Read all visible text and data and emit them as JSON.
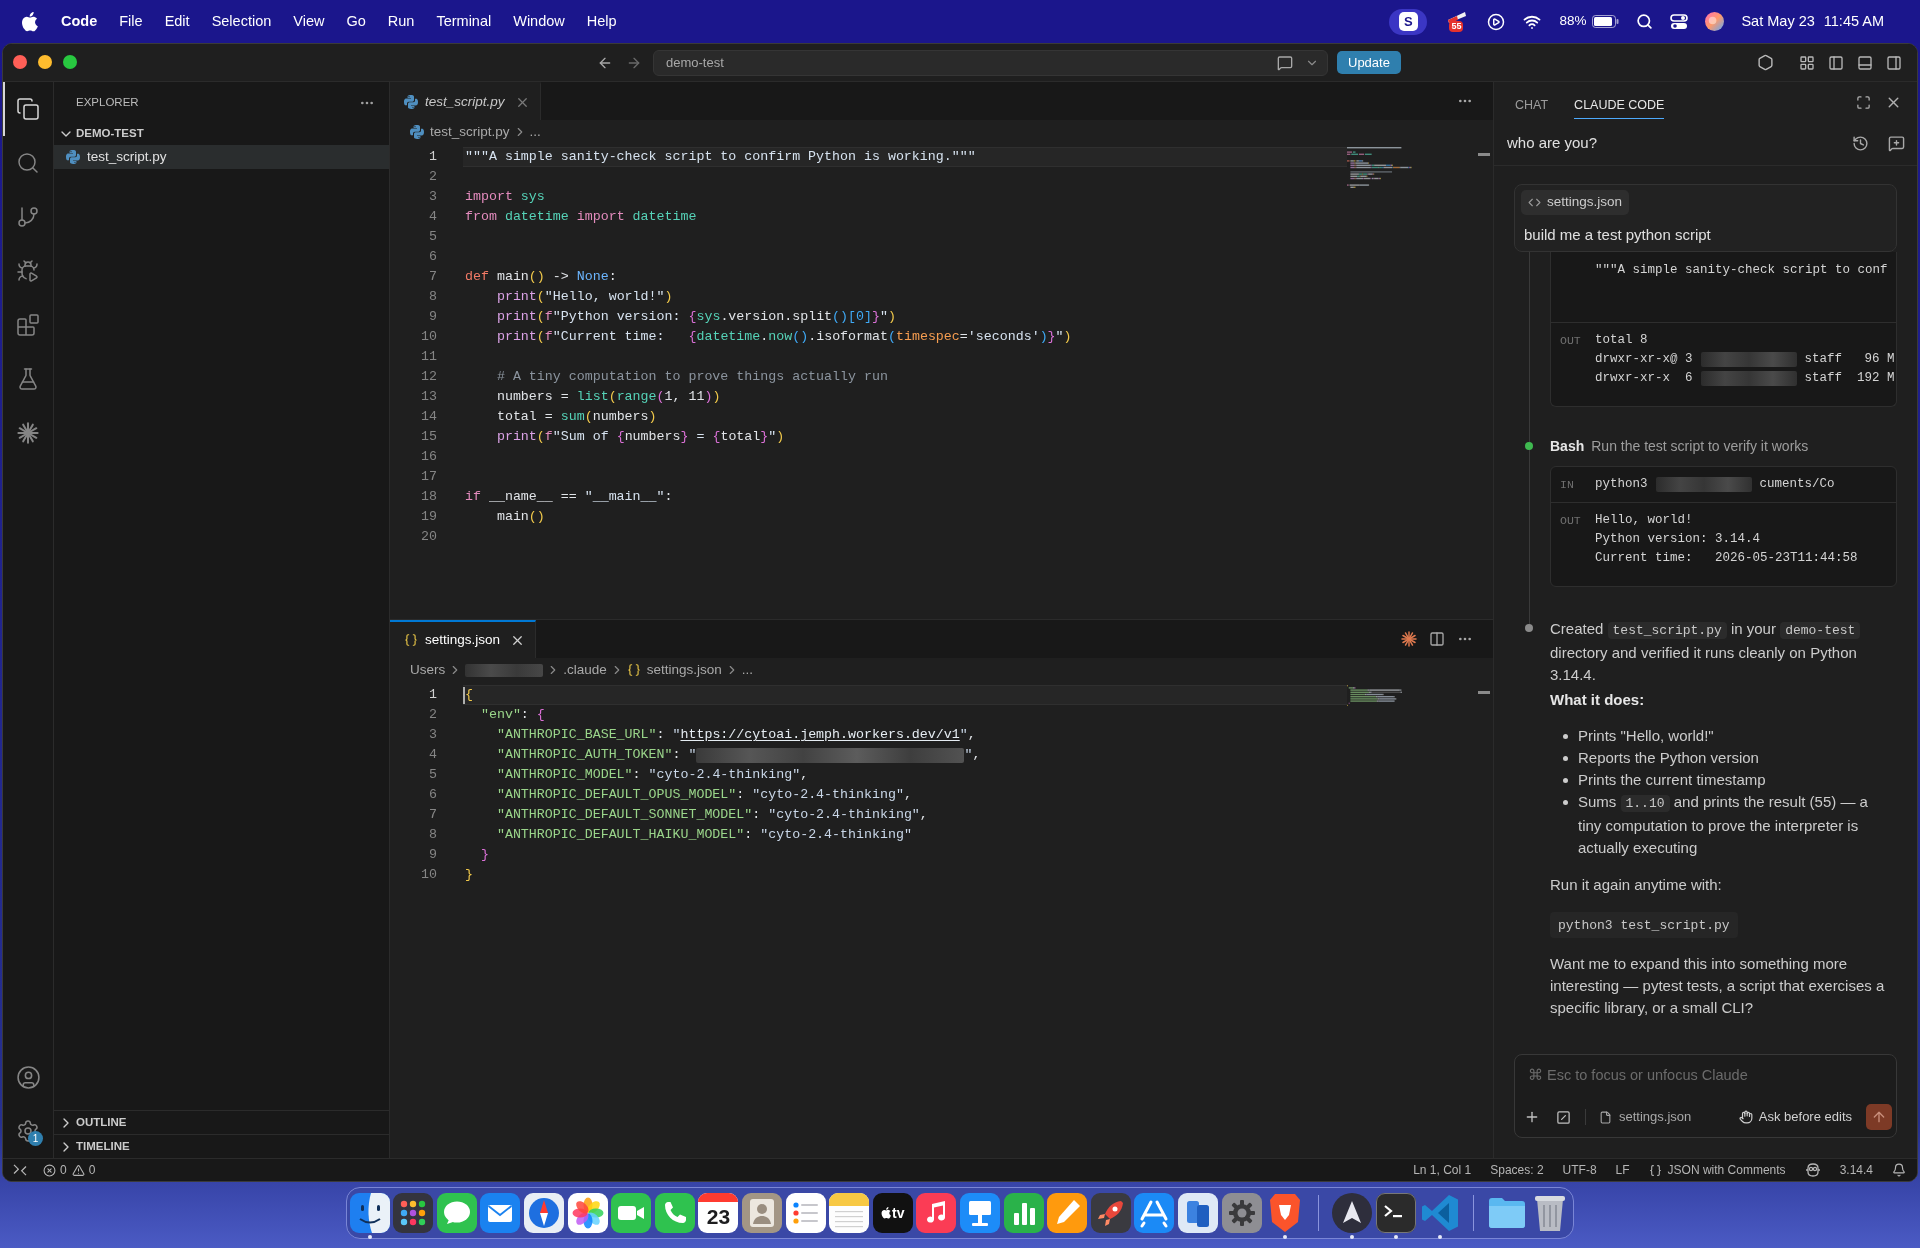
{
  "menu_bar": {
    "app_name": "Code",
    "menus": [
      "File",
      "Edit",
      "Selection",
      "View",
      "Go",
      "Run",
      "Terminal",
      "Window",
      "Help"
    ],
    "app_letter": "S",
    "badge": "55",
    "battery": "88%",
    "date": "Sat May 23",
    "time": "11:45 AM"
  },
  "title_bar": {
    "search": "demo-test",
    "update_button": "Update"
  },
  "activity_bar": {
    "items": [
      {
        "kind": "explorer",
        "selected": true
      },
      {
        "kind": "search",
        "selected": false
      },
      {
        "kind": "source_control",
        "selected": false
      },
      {
        "kind": "run",
        "selected": false
      },
      {
        "kind": "extensions",
        "selected": false
      },
      {
        "kind": "testing",
        "selected": false
      },
      {
        "kind": "claude",
        "selected": false
      }
    ],
    "settings_badge": "1"
  },
  "sidebar": {
    "title": "EXPLORER",
    "folder": {
      "name": "DEMO-TEST",
      "expanded": true,
      "children": [
        {
          "name": "test_script.py",
          "kind": "python",
          "selected": true
        }
      ]
    },
    "sections": [
      {
        "name": "OUTLINE",
        "expanded": false
      },
      {
        "name": "TIMELINE",
        "expanded": false
      }
    ]
  },
  "editor_groups": [
    {
      "focused": false,
      "tabs": [
        {
          "name": "test_script.py",
          "kind": "python",
          "selected": true,
          "preview": true
        }
      ],
      "breadcrumbs": [
        {
          "kind": "python",
          "text": "test_script.py"
        },
        {
          "kind": "text",
          "text": "..."
        }
      ],
      "lines": [
        {
          "n": "1",
          "current": true,
          "tokens": [
            {
              "kind": "str",
              "text": "\"\"\"A simple sanity-check script to confirm Python is working.\"\"\""
            }
          ]
        },
        {
          "n": "2",
          "current": false
        },
        {
          "n": "3",
          "current": false,
          "tokens": [
            {
              "kind": "kw2",
              "text": "import"
            },
            {
              "kind": "mod",
              "text": " sys"
            }
          ]
        },
        {
          "n": "4",
          "current": false,
          "tokens": [
            {
              "kind": "kw2",
              "text": "from"
            },
            {
              "kind": "mod",
              "text": " datetime"
            },
            {
              "kind": "kw2",
              "text": " import"
            },
            {
              "kind": "mod",
              "text": " datetime"
            }
          ]
        },
        {
          "n": "5",
          "current": false
        },
        {
          "n": "6",
          "current": false
        },
        {
          "n": "7",
          "current": false,
          "tokens": [
            {
              "kind": "kw",
              "text": "def"
            },
            {
              "kind": "pl",
              "text": " main"
            },
            {
              "kind": "b1",
              "text": "()"
            },
            {
              "kind": "pl",
              "text": " -> "
            },
            {
              "kind": "const",
              "text": "None"
            },
            {
              "kind": "pl",
              "text": ":"
            }
          ]
        },
        {
          "n": "8",
          "current": false,
          "tokens": [
            {
              "kind": "fn",
              "text": "    print"
            },
            {
              "kind": "b1",
              "text": "("
            },
            {
              "kind": "str",
              "text": "\"Hello, world!\""
            },
            {
              "kind": "b1",
              "text": ")"
            }
          ]
        },
        {
          "n": "9",
          "current": false,
          "tokens": [
            {
              "kind": "fn",
              "text": "    print"
            },
            {
              "kind": "b1",
              "text": "("
            },
            {
              "kind": "kw2",
              "text": "f"
            },
            {
              "kind": "str",
              "text": "\"Python version: "
            },
            {
              "kind": "b2",
              "text": "{"
            },
            {
              "kind": "mod",
              "text": "sys"
            },
            {
              "kind": "pl",
              "text": ".version.split"
            },
            {
              "kind": "b3",
              "text": "()[0]"
            },
            {
              "kind": "b2",
              "text": "}"
            },
            {
              "kind": "str",
              "text": "\""
            },
            {
              "kind": "b1",
              "text": ")"
            }
          ]
        },
        {
          "n": "10",
          "current": false,
          "tokens": [
            {
              "kind": "fn",
              "text": "    print"
            },
            {
              "kind": "b1",
              "text": "("
            },
            {
              "kind": "kw2",
              "text": "f"
            },
            {
              "kind": "str",
              "text": "\"Current time:   "
            },
            {
              "kind": "b2",
              "text": "{"
            },
            {
              "kind": "mod",
              "text": "datetime"
            },
            {
              "kind": "pl",
              "text": "."
            },
            {
              "kind": "mod",
              "text": "now"
            },
            {
              "kind": "b3",
              "text": "()"
            },
            {
              "kind": "pl",
              "text": ".isoformat"
            },
            {
              "kind": "b3",
              "text": "("
            },
            {
              "kind": "param",
              "text": "timespec"
            },
            {
              "kind": "pl",
              "text": "="
            },
            {
              "kind": "str",
              "text": "'seconds'"
            },
            {
              "kind": "b3",
              "text": ")"
            },
            {
              "kind": "b2",
              "text": "}"
            },
            {
              "kind": "str",
              "text": "\""
            },
            {
              "kind": "b1",
              "text": ")"
            }
          ]
        },
        {
          "n": "11",
          "current": false
        },
        {
          "n": "12",
          "current": false,
          "tokens": [
            {
              "kind": "cmt",
              "text": "    # A tiny computation to prove things actually run"
            }
          ]
        },
        {
          "n": "13",
          "current": false,
          "tokens": [
            {
              "kind": "pl",
              "text": "    numbers = "
            },
            {
              "kind": "mod",
              "text": "list"
            },
            {
              "kind": "b1",
              "text": "("
            },
            {
              "kind": "mod",
              "text": "range"
            },
            {
              "kind": "b2",
              "text": "("
            },
            {
              "kind": "pl",
              "text": "1, 11"
            },
            {
              "kind": "b2",
              "text": ")"
            },
            {
              "kind": "b1",
              "text": ")"
            }
          ]
        },
        {
          "n": "14",
          "current": false,
          "tokens": [
            {
              "kind": "pl",
              "text": "    total = "
            },
            {
              "kind": "mod",
              "text": "sum"
            },
            {
              "kind": "b1",
              "text": "("
            },
            {
              "kind": "pl",
              "text": "numbers"
            },
            {
              "kind": "b1",
              "text": ")"
            }
          ]
        },
        {
          "n": "15",
          "current": false,
          "tokens": [
            {
              "kind": "fn",
              "text": "    print"
            },
            {
              "kind": "b1",
              "text": "("
            },
            {
              "kind": "kw2",
              "text": "f"
            },
            {
              "kind": "str",
              "text": "\"Sum of "
            },
            {
              "kind": "b2",
              "text": "{"
            },
            {
              "kind": "pl",
              "text": "numbers"
            },
            {
              "kind": "b2",
              "text": "}"
            },
            {
              "kind": "str",
              "text": " = "
            },
            {
              "kind": "b2",
              "text": "{"
            },
            {
              "kind": "pl",
              "text": "total"
            },
            {
              "kind": "b2",
              "text": "}"
            },
            {
              "kind": "str",
              "text": "\""
            },
            {
              "kind": "b1",
              "text": ")"
            }
          ]
        },
        {
          "n": "16",
          "current": false
        },
        {
          "n": "17",
          "current": false
        },
        {
          "n": "18",
          "current": false,
          "tokens": [
            {
              "kind": "kw2",
              "text": "if"
            },
            {
              "kind": "pl",
              "text": " __name__ == "
            },
            {
              "kind": "str",
              "text": "\"__main__\""
            },
            {
              "kind": "pl",
              "text": ":"
            }
          ]
        },
        {
          "n": "19",
          "current": false,
          "tokens": [
            {
              "kind": "pl",
              "text": "    main"
            },
            {
              "kind": "b1",
              "text": "()"
            }
          ]
        },
        {
          "n": "20",
          "current": false
        }
      ]
    },
    {
      "focused": true,
      "tabs": [
        {
          "name": "settings.json",
          "kind": "json",
          "selected": true,
          "preview": false
        }
      ],
      "breadcrumbs": [
        {
          "kind": "text",
          "text": "Users"
        },
        {
          "kind": "redacted"
        },
        {
          "kind": "text",
          "text": ".claude"
        },
        {
          "kind": "json",
          "text": "settings.json"
        },
        {
          "kind": "text",
          "text": "..."
        }
      ],
      "lines": [
        {
          "n": "1",
          "current": true,
          "tokens": [
            {
              "kind": "b1",
              "text": "{"
            }
          ]
        },
        {
          "n": "2",
          "current": false,
          "tokens": [
            {
              "kind": "key",
              "text": "  \"env\""
            },
            {
              "kind": "pl",
              "text": ": "
            },
            {
              "kind": "b2",
              "text": "{"
            }
          ]
        },
        {
          "n": "3",
          "current": false,
          "tokens": [
            {
              "kind": "key",
              "text": "    \"ANTHROPIC_BASE_URL\""
            },
            {
              "kind": "pl",
              "text": ": "
            },
            {
              "kind": "val",
              "text": "\""
            },
            {
              "kind": "link",
              "text": "https://cytoai.jemph.workers.dev/v1"
            },
            {
              "kind": "val",
              "text": "\""
            },
            {
              "kind": "pl",
              "text": ","
            }
          ]
        },
        {
          "n": "4",
          "current": false,
          "tokens": [
            {
              "kind": "key",
              "text": "    \"ANTHROPIC_AUTH_TOKEN\""
            },
            {
              "kind": "pl",
              "text": ": "
            },
            {
              "kind": "val",
              "text": "\""
            },
            {
              "kind": "redacted"
            },
            {
              "kind": "val",
              "text": "\""
            },
            {
              "kind": "pl",
              "text": ","
            }
          ]
        },
        {
          "n": "5",
          "current": false,
          "tokens": [
            {
              "kind": "key",
              "text": "    \"ANTHROPIC_MODEL\""
            },
            {
              "kind": "pl",
              "text": ": "
            },
            {
              "kind": "val",
              "text": "\"cyto-2.4-thinking\""
            },
            {
              "kind": "pl",
              "text": ","
            }
          ]
        },
        {
          "n": "6",
          "current": false,
          "tokens": [
            {
              "kind": "key",
              "text": "    \"ANTHROPIC_DEFAULT_OPUS_MODEL\""
            },
            {
              "kind": "pl",
              "text": ": "
            },
            {
              "kind": "val",
              "text": "\"cyto-2.4-thinking\""
            },
            {
              "kind": "pl",
              "text": ","
            }
          ]
        },
        {
          "n": "7",
          "current": false,
          "tokens": [
            {
              "kind": "key",
              "text": "    \"ANTHROPIC_DEFAULT_SONNET_MODEL\""
            },
            {
              "kind": "pl",
              "text": ": "
            },
            {
              "kind": "val",
              "text": "\"cyto-2.4-thinking\""
            },
            {
              "kind": "pl",
              "text": ","
            }
          ]
        },
        {
          "n": "8",
          "current": false,
          "tokens": [
            {
              "kind": "key",
              "text": "    \"ANTHROPIC_DEFAULT_HAIKU_MODEL\""
            },
            {
              "kind": "pl",
              "text": ": "
            },
            {
              "kind": "val",
              "text": "\"cyto-2.4-thinking\""
            }
          ]
        },
        {
          "n": "9",
          "current": false,
          "tokens": [
            {
              "kind": "b2",
              "text": "  }"
            }
          ]
        },
        {
          "n": "10",
          "current": false,
          "tokens": [
            {
              "kind": "b1",
              "text": "}"
            }
          ]
        }
      ]
    }
  ],
  "chat_panel": {
    "tabs": [
      {
        "label": "CHAT",
        "selected": false
      },
      {
        "label": "CLAUDE CODE",
        "selected": true
      }
    ],
    "session_title": "who are you?",
    "user_message": {
      "attachment": "settings.json",
      "text": "build me a test python script"
    },
    "transcript": [
      {
        "kind": "output",
        "blocks": [
          {
            "lines": [
              [
                {
                  "kind": "text",
                  "text": "\"\"\"A simple sanity-check script to conf"
                }
              ]
            ]
          },
          {
            "label": "OUT",
            "lines": [
              [
                {
                  "kind": "text",
                  "text": "total 8"
                }
              ],
              [
                {
                  "kind": "text",
                  "text": "drwxr-xr-x@ 3"
                },
                {
                  "kind": "redacted"
                },
                {
                  "kind": "text",
                  "text": "staff   96 M"
                }
              ],
              [
                {
                  "kind": "text",
                  "text": "drwxr-xr-x  6"
                },
                {
                  "kind": "redacted"
                },
                {
                  "kind": "text",
                  "text": "staff  192 M"
                }
              ]
            ]
          }
        ]
      },
      {
        "kind": "tool",
        "color": "#3fb950",
        "tool": "Bash",
        "description": "Run the test script to verify it works",
        "blocks": [
          {
            "label": "IN",
            "lines": [
              [
                {
                  "kind": "text",
                  "text": "python3"
                },
                {
                  "kind": "redacted"
                },
                {
                  "kind": "text",
                  "text": "cuments/Co"
                }
              ]
            ]
          },
          {
            "label": "OUT",
            "lines": [
              [
                {
                  "kind": "text",
                  "text": "Hello, world!"
                }
              ],
              [
                {
                  "kind": "text",
                  "text": "Python version: 3.14.4"
                }
              ],
              [
                {
                  "kind": "text",
                  "text": "Current time:   2026-05-23T11:44:58"
                }
              ]
            ]
          }
        ]
      },
      {
        "kind": "message",
        "color": "#8b8b8b",
        "content": [
          {
            "kind": "paragraph",
            "segments": [
              {
                "kind": "text",
                "text": "Created "
              },
              {
                "kind": "code",
                "text": "test_script.py"
              },
              {
                "kind": "text",
                "text": " in your "
              },
              {
                "kind": "code",
                "text": "demo-test"
              },
              {
                "kind": "text",
                "text": " directory and verified it runs cleanly on Python 3.14.4."
              }
            ]
          },
          {
            "kind": "heading",
            "text": "What it does:"
          },
          {
            "kind": "bullets",
            "items": [
              [
                {
                  "kind": "text",
                  "text": "Prints \"Hello, world!\""
                }
              ],
              [
                {
                  "kind": "text",
                  "text": "Reports the Python version"
                }
              ],
              [
                {
                  "kind": "text",
                  "text": "Prints the current timestamp"
                }
              ],
              [
                {
                  "kind": "text",
                  "text": "Sums "
                },
                {
                  "kind": "code",
                  "text": "1..10"
                },
                {
                  "kind": "text",
                  "text": " and prints the result (55) — a tiny computation to prove the interpreter is actually executing"
                }
              ]
            ]
          },
          {
            "kind": "paragraph",
            "segments": [
              {
                "kind": "text",
                "text": "Run it again anytime with:"
              }
            ]
          },
          {
            "kind": "code",
            "text": "python3 test_script.py"
          },
          {
            "kind": "paragraph",
            "segments": [
              {
                "kind": "text",
                "text": "Want me to expand this into something more interesting — pytest tests, a script that exercises a specific library, or a small CLI?"
              }
            ]
          }
        ]
      }
    ],
    "input": {
      "placeholder": "⌘ Esc to focus or unfocus Claude",
      "attachment": "settings.json",
      "mode": "Ask before edits",
      "send_disabled": true
    }
  },
  "status_bar": {
    "errors": "0",
    "warnings": "0",
    "items": [
      {
        "kind": "text",
        "text": "Ln 1, Col 1"
      },
      {
        "kind": "text",
        "text": "Spaces: 2"
      },
      {
        "kind": "text",
        "text": "UTF-8"
      },
      {
        "kind": "text",
        "text": "LF"
      },
      {
        "kind": "language",
        "text": "JSON with Comments"
      },
      {
        "kind": "assistant"
      },
      {
        "kind": "text",
        "text": "3.14.4"
      },
      {
        "kind": "bell"
      }
    ]
  },
  "dock": {
    "sections": [
      {
        "apps": [
          {
            "kind": "face",
            "running": true
          },
          {
            "kind": "grid",
            "running": false
          },
          {
            "kind": "chat",
            "running": false
          },
          {
            "kind": "mail",
            "running": false
          },
          {
            "kind": "compass",
            "running": false
          },
          {
            "kind": "photos",
            "running": false
          },
          {
            "kind": "video",
            "running": false
          },
          {
            "kind": "phone",
            "running": false
          },
          {
            "kind": "calendar",
            "text": "23",
            "running": false
          },
          {
            "kind": "contacts",
            "running": false
          },
          {
            "kind": "list",
            "running": false
          },
          {
            "kind": "notes",
            "running": false
          },
          {
            "kind": "tv",
            "text": "tv",
            "running": false
          },
          {
            "kind": "music",
            "running": false
          },
          {
            "kind": "podium",
            "running": false
          },
          {
            "kind": "bars",
            "running": false
          },
          {
            "kind": "pen",
            "running": false
          },
          {
            "kind": "rocket",
            "running": false
          },
          {
            "kind": "store",
            "running": false
          },
          {
            "kind": "devices",
            "running": false
          },
          {
            "kind": "gear",
            "running": false
          },
          {
            "kind": "lion",
            "running": true
          }
        ]
      },
      {
        "apps": [
          {
            "kind": "arrow",
            "running": true
          },
          {
            "kind": "terminal",
            "running": true
          },
          {
            "kind": "code",
            "running": true
          }
        ]
      },
      {
        "apps": [
          {
            "kind": "folder",
            "running": false
          },
          {
            "kind": "trash",
            "running": false
          }
        ]
      }
    ]
  }
}
